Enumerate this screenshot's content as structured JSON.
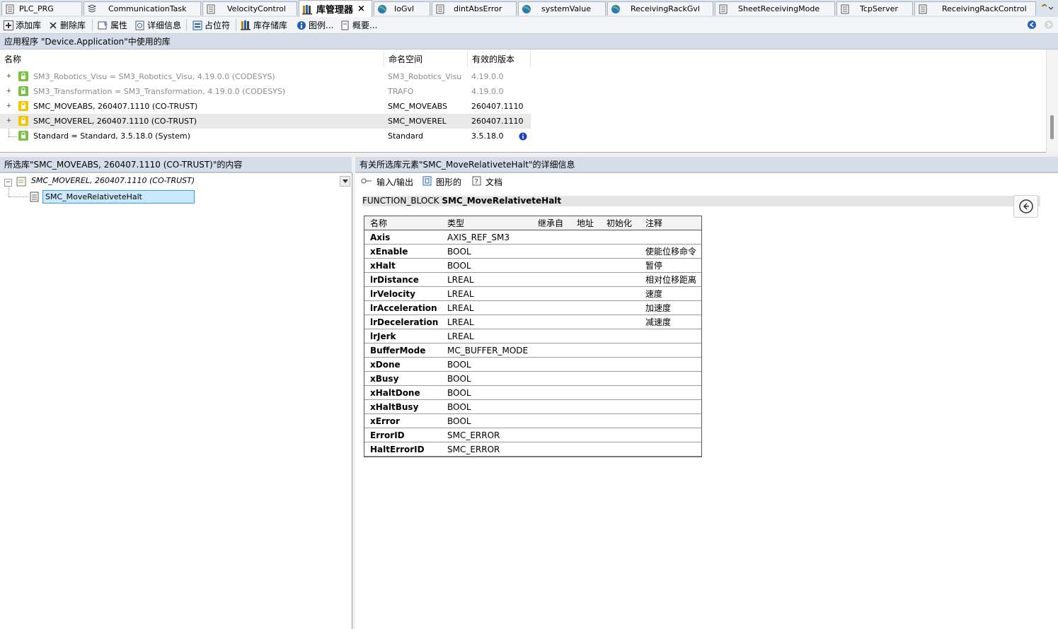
{
  "tabs": [
    {
      "label": "PLC_PRG",
      "icon": "document-icon"
    },
    {
      "label": "CommunicationTask",
      "icon": "task-icon"
    },
    {
      "label": "VelocityControl",
      "icon": "document-icon"
    },
    {
      "label": "库管理器",
      "icon": "library-icon",
      "close": "×"
    },
    {
      "label": "IoGvl",
      "icon": "globe-icon"
    },
    {
      "label": "dintAbsError",
      "icon": "document-icon"
    },
    {
      "label": "systemValue",
      "icon": "globe-icon"
    },
    {
      "label": "ReceivingRackGvl",
      "icon": "globe-icon"
    },
    {
      "label": "SheetReceivingMode",
      "icon": "document-icon"
    },
    {
      "label": "TcpServer",
      "icon": "document-icon"
    },
    {
      "label": "ReceivingRackControl",
      "icon": "document-icon"
    }
  ],
  "toolbar": {
    "add_library": "添加库",
    "delete_library": "删除库",
    "properties": "属性",
    "details": "详细信息",
    "placeholder": "占位符",
    "library_repository": "库存储库",
    "icons": "图例...",
    "summary": "概要..."
  },
  "libraries": {
    "header": "应用程序 \"Device.Application\"中使用的库",
    "columns": {
      "name": "名称",
      "namespace": "命名空间",
      "version": "有效的版本"
    },
    "rows": [
      {
        "name": "SM3_Robotics_Visu = SM3_Robotics_Visu, 4.19.0.0 (CODESYS)",
        "namespace": "SM3_Robotics_Visu",
        "version": "4.19.0.0",
        "dim": true,
        "expandable": true,
        "icon_color": "#7ac143"
      },
      {
        "name": "SM3_Transformation = SM3_Transformation, 4.19.0.0 (CODESYS)",
        "namespace": "TRAFO",
        "version": "4.19.0.0",
        "dim": true,
        "expandable": true,
        "icon_color": "#7ac143"
      },
      {
        "name": "SMC_MOVEABS, 260407.1110 (CO-TRUST)",
        "namespace": "SMC_MOVEABS",
        "version": "260407.1110",
        "dim": false,
        "expandable": true,
        "icon_color": "#f5c400"
      },
      {
        "name": "SMC_MOVEREL, 260407.1110 (CO-TRUST)",
        "namespace": "SMC_MOVEREL",
        "version": "260407.1110",
        "dim": false,
        "expandable": true,
        "icon_color": "#f5c400",
        "selected": true
      },
      {
        "name": "Standard = Standard, 3.5.18.0 (System)",
        "namespace": "Standard",
        "version": "3.5.18.0",
        "dim": false,
        "expandable": false,
        "icon_color": "#7ac143",
        "info": true
      }
    ]
  },
  "contents": {
    "header": "所选库\"SMC_MOVEABS, 260407.1110 (CO-TRUST)\"的内容",
    "root": "SMC_MOVEREL, 260407.1110 (CO-TRUST)",
    "child": "SMC_MoveRelativeteHalt"
  },
  "details": {
    "header": "有关所选库元素\"SMC_MoveRelativeteHalt\"的详细信息",
    "subtabs": [
      "输入/输出",
      "图形的",
      "文档"
    ],
    "fb_keyword": "FUNCTION_BLOCK",
    "fb_name": "SMC_MoveRelativeteHalt",
    "columns": [
      "名称",
      "类型",
      "继承自",
      "地址",
      "初始化",
      "注释"
    ],
    "vars": [
      {
        "name": "Axis",
        "type": "AXIS_REF_SM3",
        "comment": ""
      },
      {
        "name": "xEnable",
        "type": "BOOL",
        "comment": "使能位移命令"
      },
      {
        "name": "xHalt",
        "type": "BOOL",
        "comment": "暂停"
      },
      {
        "name": "lrDistance",
        "type": "LREAL",
        "comment": "相对位移距离"
      },
      {
        "name": "lrVelocity",
        "type": "LREAL",
        "comment": "速度"
      },
      {
        "name": "lrAcceleration",
        "type": "LREAL",
        "comment": "加速度"
      },
      {
        "name": "lrDeceleration",
        "type": "LREAL",
        "comment": "减速度"
      },
      {
        "name": "lrJerk",
        "type": "LREAL",
        "comment": ""
      },
      {
        "name": "BufferMode",
        "type": "MC_BUFFER_MODE",
        "comment": ""
      },
      {
        "name": "xDone",
        "type": "BOOL",
        "comment": ""
      },
      {
        "name": "xBusy",
        "type": "BOOL",
        "comment": ""
      },
      {
        "name": "xHaltDone",
        "type": "BOOL",
        "comment": ""
      },
      {
        "name": "xHaltBusy",
        "type": "BOOL",
        "comment": ""
      },
      {
        "name": "xError",
        "type": "BOOL",
        "comment": ""
      },
      {
        "name": "ErrorID",
        "type": "SMC_ERROR",
        "comment": ""
      },
      {
        "name": "HaltErrorID",
        "type": "SMC_ERROR",
        "comment": ""
      }
    ]
  },
  "colors": {
    "header_bg": "#d5dde8",
    "tab_bar": "#dde3ea",
    "selection": "#cce8ff",
    "accent": "#1f5fbf"
  }
}
